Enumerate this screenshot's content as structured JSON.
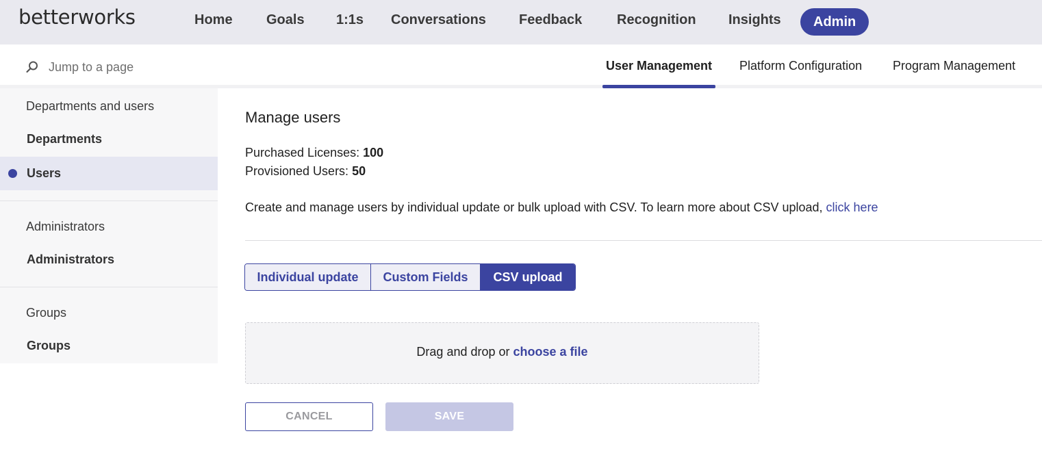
{
  "brand": {
    "logo_text": "betterworks"
  },
  "topnav": {
    "items": [
      {
        "label": "Home"
      },
      {
        "label": "Goals"
      },
      {
        "label": "1:1s"
      },
      {
        "label": "Conversations"
      },
      {
        "label": "Feedback"
      },
      {
        "label": "Recognition"
      },
      {
        "label": "Insights"
      },
      {
        "label": "Admin",
        "active": true
      }
    ]
  },
  "search": {
    "placeholder": "Jump to a page",
    "icon": "search-icon"
  },
  "subtabs": [
    {
      "label": "User Management",
      "active": true
    },
    {
      "label": "Platform Configuration"
    },
    {
      "label": "Program Management"
    }
  ],
  "sidebar": {
    "sections": [
      {
        "heading": "Departments and users",
        "items": [
          {
            "label": "Departments"
          },
          {
            "label": "Users",
            "active": true
          }
        ]
      },
      {
        "heading": "Administrators",
        "items": [
          {
            "label": "Administrators"
          }
        ]
      },
      {
        "heading": "Groups",
        "items": [
          {
            "label": "Groups"
          }
        ]
      }
    ]
  },
  "main": {
    "title": "Manage users",
    "purchased_label": "Purchased Licenses:",
    "purchased_value": "100",
    "provisioned_label": "Provisioned Users:",
    "provisioned_value": "50",
    "description": "Create and manage users by individual update or bulk upload with CSV. To learn more about CSV upload,",
    "description_link": "click here",
    "segments": [
      {
        "label": "Individual update"
      },
      {
        "label": "Custom Fields"
      },
      {
        "label": "CSV upload",
        "active": true
      }
    ],
    "dropzone_text": "Drag and drop or",
    "dropzone_link": "choose a file",
    "cancel_label": "CANCEL",
    "save_label": "SAVE"
  },
  "colors": {
    "accent": "#3b44a0",
    "nav_bg": "#e9e9ef",
    "sidebar_bg": "#f7f7f8",
    "save_disabled": "#c5c7e4"
  }
}
